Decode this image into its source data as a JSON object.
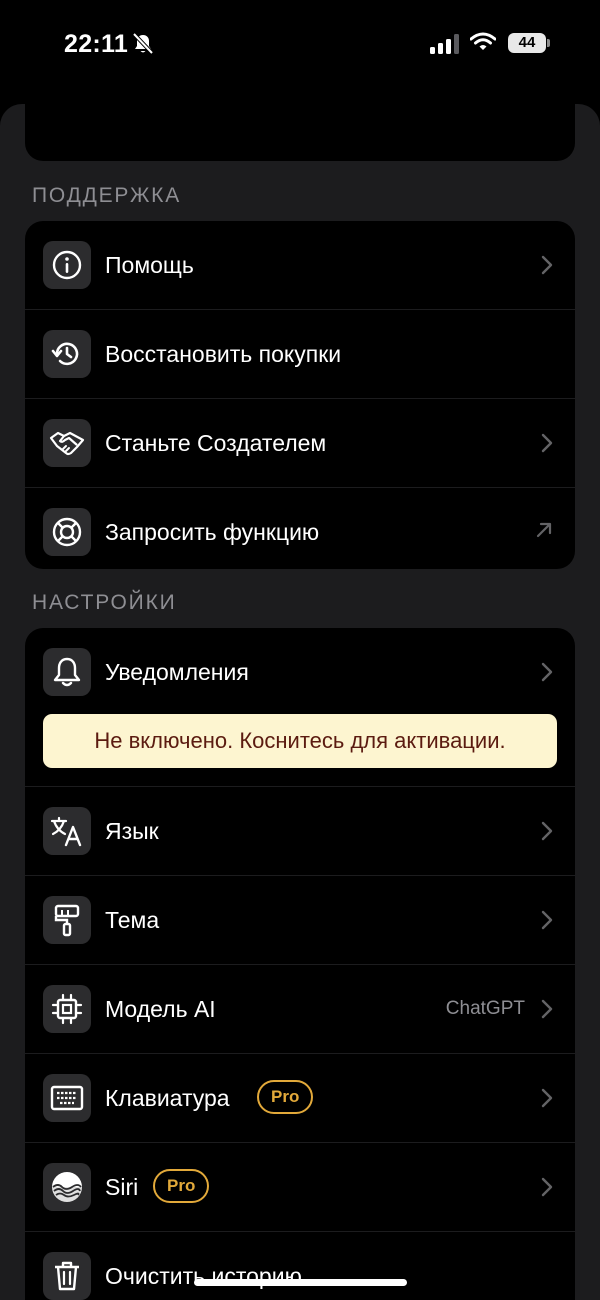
{
  "status_bar": {
    "time": "22:11",
    "battery": "44",
    "icons": [
      "bell-slash-icon",
      "cellular-signal-icon",
      "wifi-icon",
      "battery-icon"
    ]
  },
  "sections": {
    "support": {
      "title": "ПОДДЕРЖКА",
      "items": [
        {
          "label": "Помощь",
          "icon": "info-icon",
          "accessory": "chevron"
        },
        {
          "label": "Восстановить покупки",
          "icon": "history-icon",
          "accessory": "none"
        },
        {
          "label": "Станьте Создателем",
          "icon": "handshake-icon",
          "accessory": "chevron"
        },
        {
          "label": "Запросить функцию",
          "icon": "lifebuoy-icon",
          "accessory": "external-arrow"
        }
      ]
    },
    "settings": {
      "title": "НАСТРОЙКИ",
      "items": [
        {
          "label": "Уведомления",
          "icon": "bell-icon",
          "accessory": "chevron",
          "notice": "Не включено. Коснитесь для активации."
        },
        {
          "label": "Язык",
          "icon": "translate-icon",
          "accessory": "chevron"
        },
        {
          "label": "Тема",
          "icon": "paint-roller-icon",
          "accessory": "chevron"
        },
        {
          "label": "Модель AI",
          "icon": "cpu-chip-icon",
          "accessory": "chevron",
          "value": "ChatGPT"
        },
        {
          "label": "Клавиатура",
          "icon": "keyboard-icon",
          "accessory": "chevron",
          "badge": "Pro"
        },
        {
          "label": "Siri",
          "icon": "siri-icon",
          "accessory": "chevron",
          "badge": "Pro"
        },
        {
          "label": "Очистить историю",
          "icon": "trash-icon",
          "accessory": "none"
        }
      ]
    }
  },
  "colors": {
    "background": "#000000",
    "sheet": "#1c1c1e",
    "card": "#000000",
    "icon_tile": "#2c2c2e",
    "secondary_text": "#8e8e93",
    "pro_badge": "#e2a93a",
    "notice_bg": "#fdf5d0",
    "notice_text": "#5b1b10"
  }
}
